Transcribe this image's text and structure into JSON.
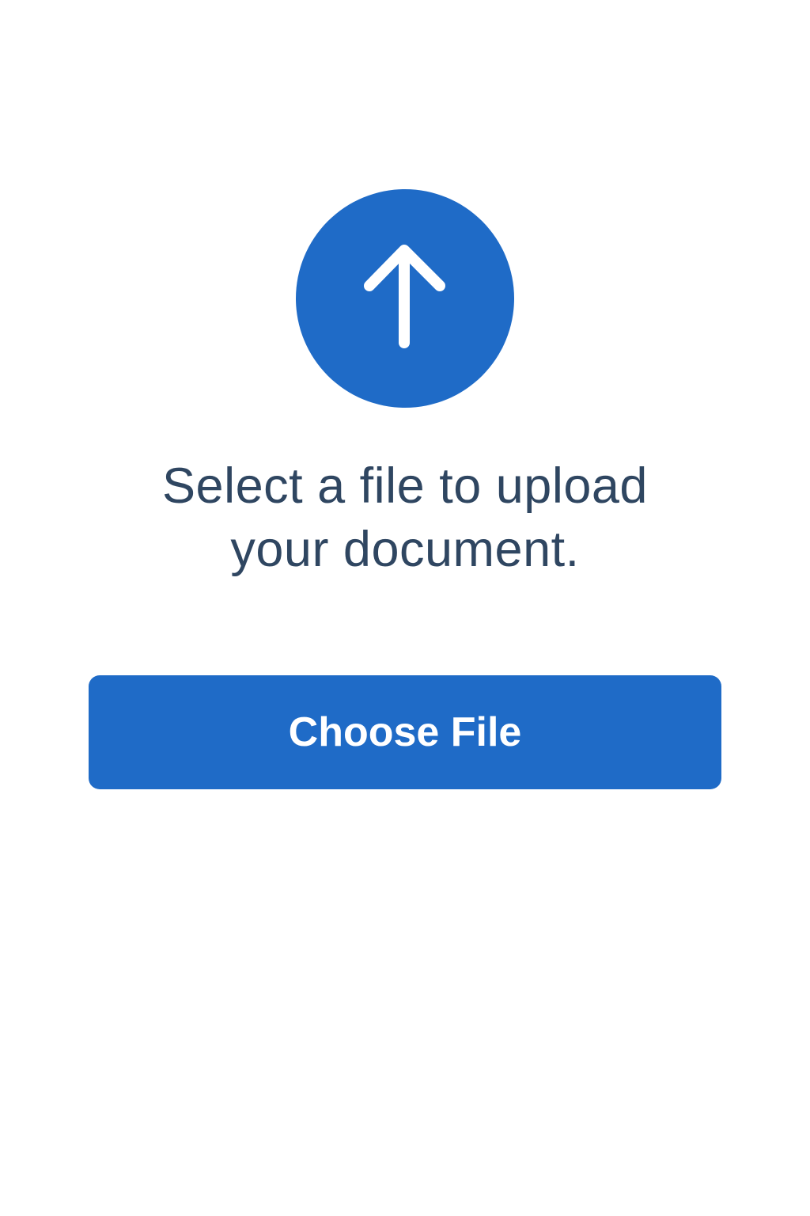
{
  "upload": {
    "icon": "upload-arrow-icon",
    "message_line1": "Select a file to upload",
    "message_line2": "your document.",
    "button_label": "Choose File"
  },
  "colors": {
    "accent": "#1f6bc7",
    "text": "#2f4661",
    "background": "#ffffff",
    "button_text": "#ffffff"
  }
}
